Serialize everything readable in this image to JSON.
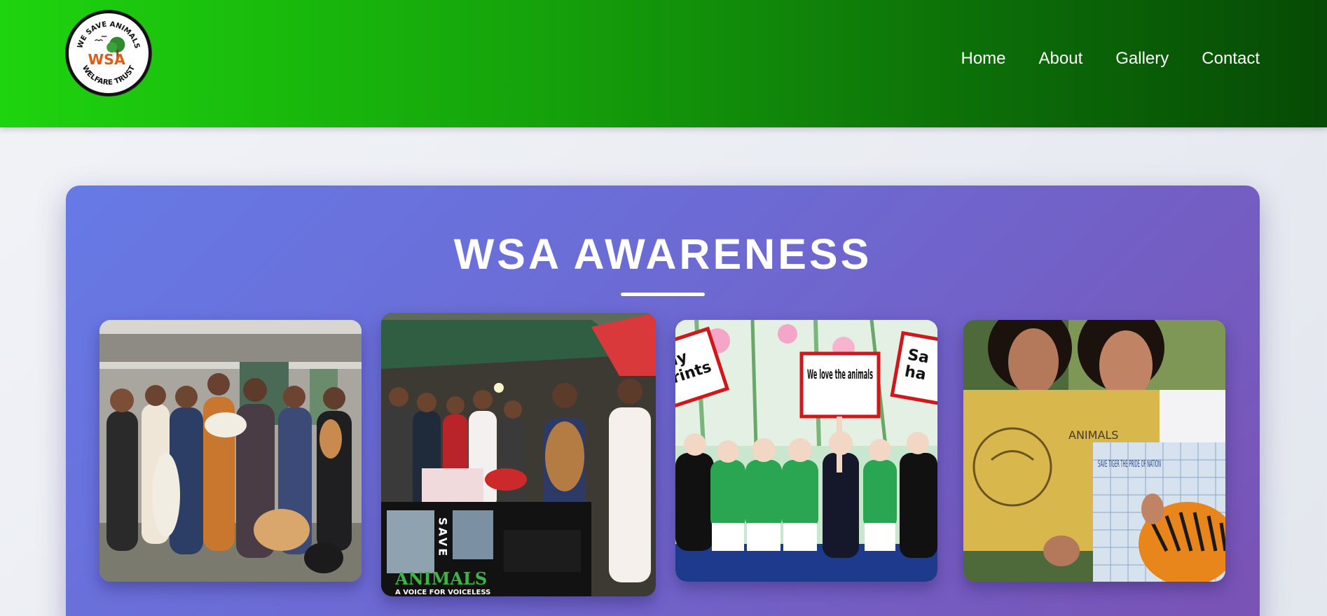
{
  "header": {
    "logo": {
      "alt": "We Save Animals Welfare Trust logo",
      "ring_top": "WE SAVE ANIMALS",
      "ring_bottom": "WELFARE TRUST",
      "mark": "WSA"
    },
    "nav": [
      {
        "label": "Home"
      },
      {
        "label": "About"
      },
      {
        "label": "Gallery"
      },
      {
        "label": "Contact"
      }
    ]
  },
  "awareness": {
    "title": "WSA AWARENESS",
    "photos": [
      {
        "alt": "Group of volunteers holding rescued dogs"
      },
      {
        "alt": "Awareness stall with banner",
        "banner_save": "SAVE",
        "banner_animals": "ANIMALS",
        "banner_voice": "A VOICE FOR VOICELESS"
      },
      {
        "alt": "Children holding placards",
        "placard_main": "We love the animals",
        "placard_left": "lly\nrints",
        "placard_right": "Sa\nha"
      },
      {
        "alt": "Students holding tiger drawings",
        "placard_text": "SAVE TIGER THE PRIDE OF NATION",
        "poster_text": "ANIMALS"
      }
    ]
  },
  "colors": {
    "header_start": "#1ed40e",
    "header_end": "#064a05",
    "card_start": "#667ae6",
    "card_end": "#7a52b4"
  }
}
